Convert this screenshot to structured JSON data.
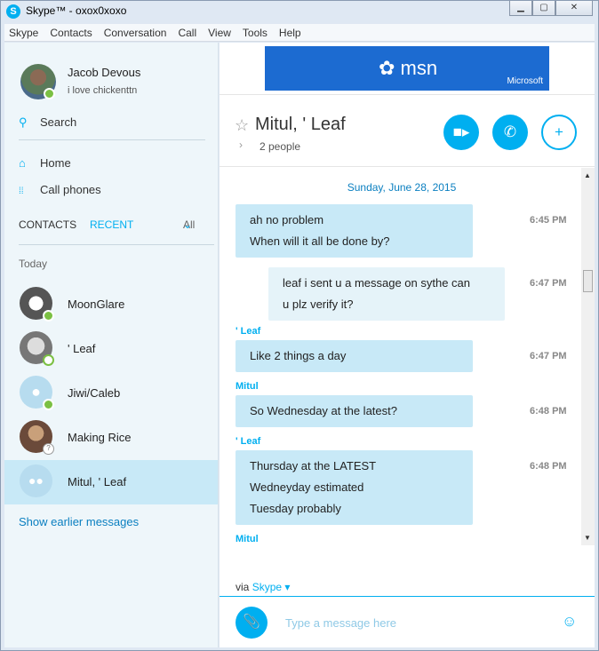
{
  "window": {
    "title": "Skype™ - oxox0xoxo",
    "icon": "skype-logo-icon",
    "buttons": [
      "minimize",
      "maximize",
      "close"
    ]
  },
  "menu": [
    "Skype",
    "Contacts",
    "Conversation",
    "Call",
    "View",
    "Tools",
    "Help"
  ],
  "profile": {
    "name": "Jacob Devous",
    "mood": "i love chickenttn",
    "status": "online"
  },
  "search": {
    "label": "Search",
    "icon": "search-icon"
  },
  "nav": [
    {
      "label": "Home",
      "icon": "home-icon"
    },
    {
      "label": "Call phones",
      "icon": "dialpad-icon"
    }
  ],
  "tabs": {
    "contacts": "CONTACTS",
    "recent": "RECENT",
    "filter": "All"
  },
  "section_label": "Today",
  "contacts": [
    {
      "name": "MoonGlare",
      "status": "online"
    },
    {
      "name": "' Leaf",
      "status": "offline"
    },
    {
      "name": "Jiwi/Caleb",
      "status": "online"
    },
    {
      "name": "Making Rice",
      "status": "unknown"
    },
    {
      "name": "Mitul, ' Leaf",
      "status": "group",
      "selected": true
    }
  ],
  "show_earlier": "Show earlier messages",
  "ad": {
    "logo": "msn",
    "brand": "Microsoft"
  },
  "chat": {
    "title": "Mitul, ' Leaf",
    "people": "2 people",
    "date": "Sunday, June 28, 2015",
    "messages": [
      {
        "sender": "",
        "lines": [
          "ah no problem",
          "When will it all be done by?"
        ],
        "time": "6:45 PM",
        "mine": false
      },
      {
        "sender": "",
        "lines": [
          "leaf i sent u a message on sythe can",
          "u plz verify it?"
        ],
        "time": "6:47 PM",
        "mine": true
      },
      {
        "sender": "' Leaf",
        "lines": [
          "Like 2 things a day"
        ],
        "time": "6:47 PM",
        "mine": false
      },
      {
        "sender": "Mitul",
        "lines": [
          "So Wednesday at the latest?"
        ],
        "time": "6:48 PM",
        "mine": false
      },
      {
        "sender": "' Leaf",
        "lines": [
          "Thursday at the LATEST",
          "Wedneyday estimated",
          "Tuesday probably"
        ],
        "time": "6:48 PM",
        "mine": false
      },
      {
        "sender": "Mitul",
        "lines": [],
        "time": "",
        "mine": false
      }
    ],
    "via_prefix": "via",
    "via_service": "Skype",
    "input_placeholder": "Type a message here"
  },
  "colors": {
    "accent": "#00aff0",
    "bubble": "#c8e9f7",
    "bubble_mine": "#e5f3f9",
    "left_bg": "#eef6fa",
    "selected": "#c8e9f7"
  }
}
